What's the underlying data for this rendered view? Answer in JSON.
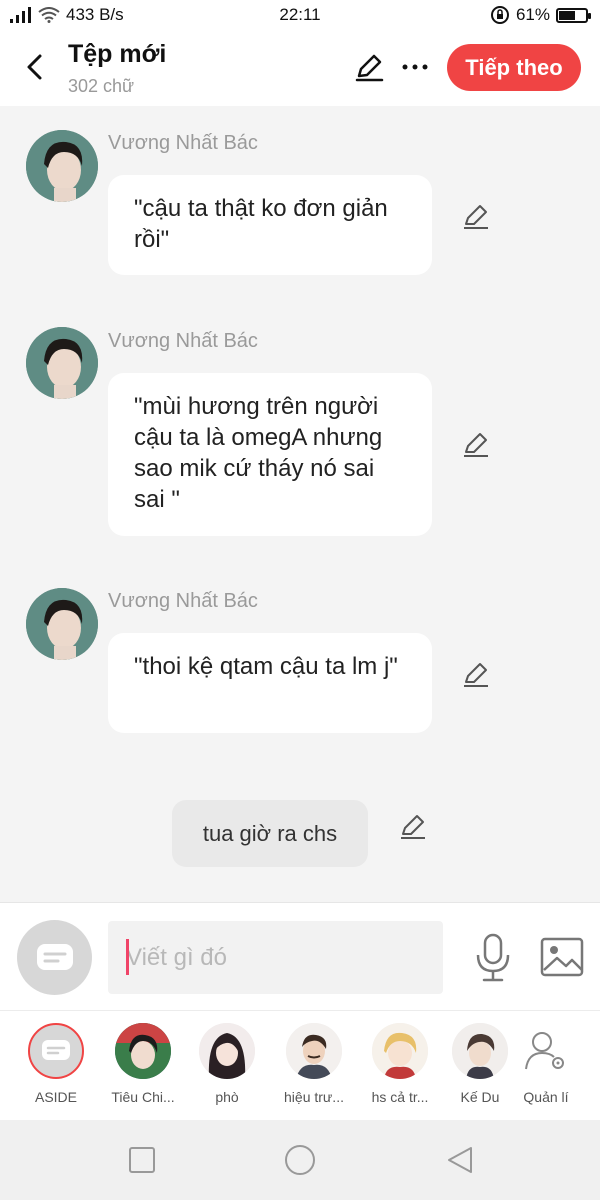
{
  "status_bar": {
    "signal": ".. ll",
    "speed": "433 B/s",
    "time": "22:11",
    "battery": "61%",
    "battery_level": 0.61
  },
  "header": {
    "title": "Tệp mới",
    "word_count": "302 chữ",
    "next_label": "Tiếp theo"
  },
  "messages": [
    {
      "sender": "Vương Nhất Bác",
      "text": "\"cậu ta thật ko đơn giản rồi\""
    },
    {
      "sender": "Vương Nhất Bác",
      "text": "\"mùi hương trên người cậu ta là omegA nhưng sao mik cứ tháy nó sai sai \""
    },
    {
      "sender": "Vương Nhất Bác",
      "text": "\"thoi kệ qtam cậu ta lm j\""
    }
  ],
  "narration": "tua giờ ra chs",
  "input": {
    "placeholder": "Viết gì đó"
  },
  "characters": [
    {
      "label": "ASIDE"
    },
    {
      "label": "Tiêu Chi..."
    },
    {
      "label": "phò"
    },
    {
      "label": "hiệu trư..."
    },
    {
      "label": "hs cả tr..."
    },
    {
      "label": "Kế Du"
    },
    {
      "label": "Quản lí"
    }
  ],
  "colors": {
    "accent": "#f04444",
    "caret": "#f04468"
  }
}
